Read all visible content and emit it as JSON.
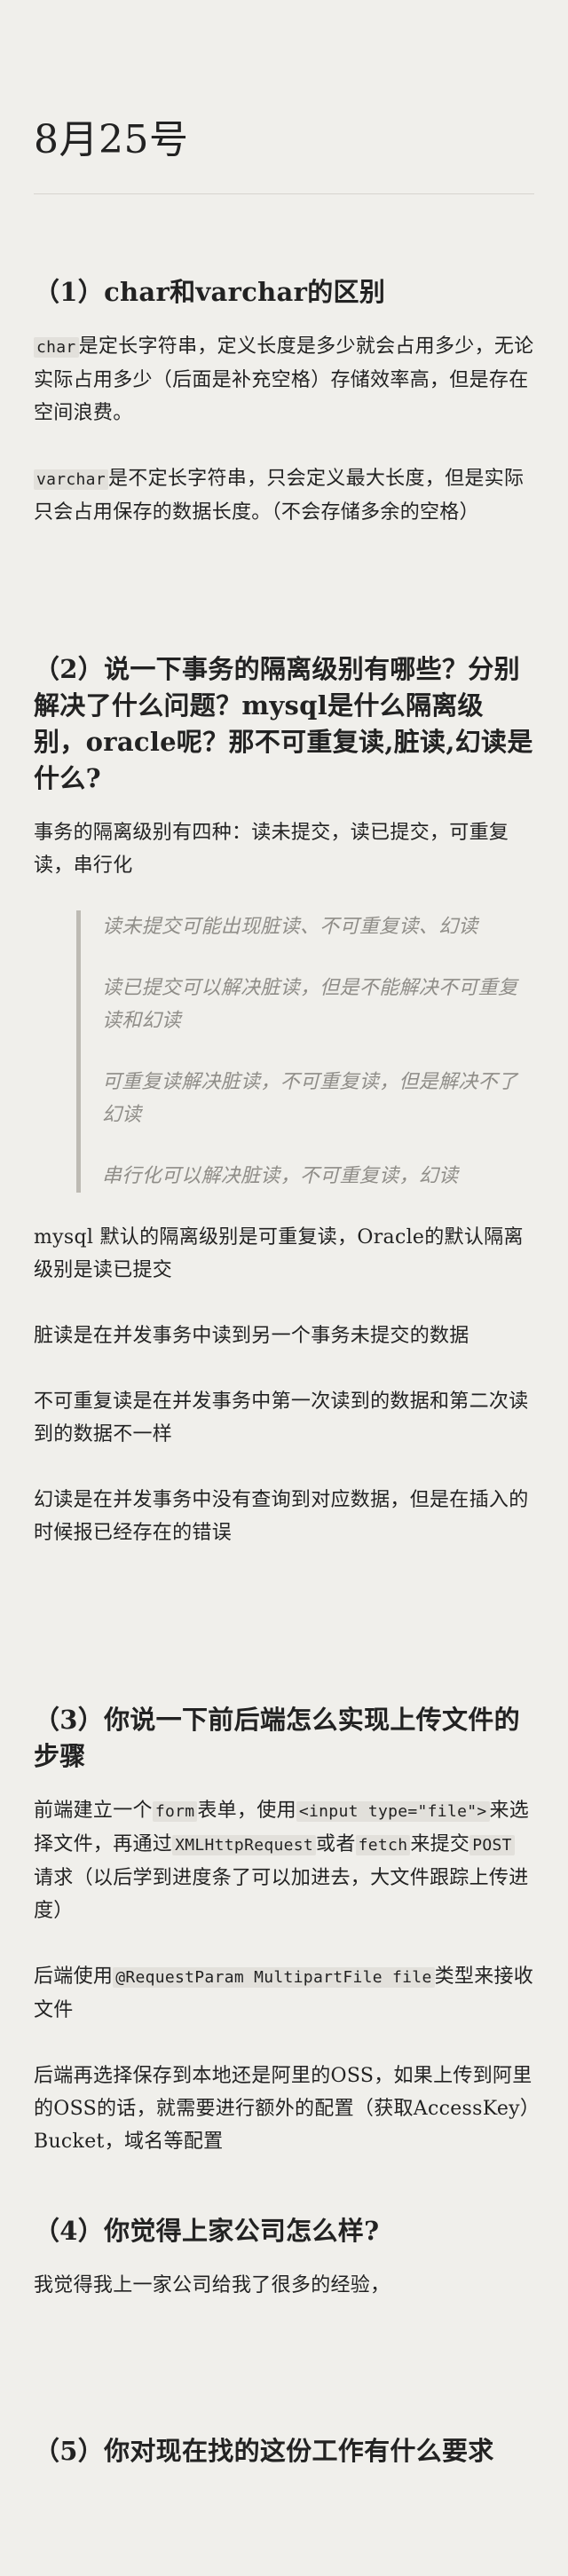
{
  "title": "8月25号",
  "sections": [
    {
      "heading": "（1）char和varchar的区别",
      "p1_code": "char",
      "p1_text": "是定长字符串，定义长度是多少就会占用多少，无论实际占用多少（后面是补充空格）存储效率高，但是存在空间浪费。",
      "p2_code": "varchar",
      "p2_text": "是不定长字符串，只会定义最大长度，但是实际只会占用保存的数据长度。（不会存储多余的空格）"
    },
    {
      "heading": "（2）说一下事务的隔离级别有哪些？分别解决了什么问题？mysql是什么隔离级别，oracle呢？那不可重复读,脏读,幻读是什么?",
      "intro": "事务的隔离级别有四种：读未提交，读已提交，可重复读，串行化",
      "quote": [
        "读未提交可能出现脏读、不可重复读、幻读",
        "读已提交可以解决脏读，但是不能解决不可重复读和幻读",
        "可重复读解决脏读，不可重复读，但是解决不了幻读",
        "串行化可以解决脏读，不可重复读，幻读"
      ],
      "p_mysql": "mysql 默认的隔离级别是可重复读，Oracle的默认隔离级别是读已提交",
      "p_dirty": "脏读是在并发事务中读到另一个事务未提交的数据",
      "p_nonrepeat": "不可重复读是在并发事务中第一次读到的数据和第二次读到的数据不一样",
      "p_phantom": "幻读是在并发事务中没有查询到对应数据，但是在插入的时候报已经存在的错误"
    },
    {
      "heading": "（3）你说一下前后端怎么实现上传文件的步骤",
      "p1_a": "前端建立一个",
      "p1_code1": "form",
      "p1_b": "表单，使用",
      "p1_code2": "<input type=\"file\">",
      "p1_c": "来选择文件，再通过",
      "p1_code3": "XMLHttpRequest",
      "p1_d": "或者",
      "p1_code4": "fetch",
      "p1_e": "来提交",
      "p1_code5": "POST",
      "p1_f": "请求（以后学到进度条了可以加进去，大文件跟踪上传进度）",
      "p2_a": "后端使用",
      "p2_code": "@RequestParam MultipartFile file",
      "p2_b": "类型来接收文件",
      "p3": "后端再选择保存到本地还是阿里的OSS，如果上传到阿里的OSS的话，就需要进行额外的配置（获取AccessKey）Bucket，域名等配置"
    },
    {
      "heading": "（4）你觉得上家公司怎么样?",
      "p1": "我觉得我上一家公司给我了很多的经验，"
    },
    {
      "heading": "（5）你对现在找的这份工作有什么要求"
    }
  ]
}
